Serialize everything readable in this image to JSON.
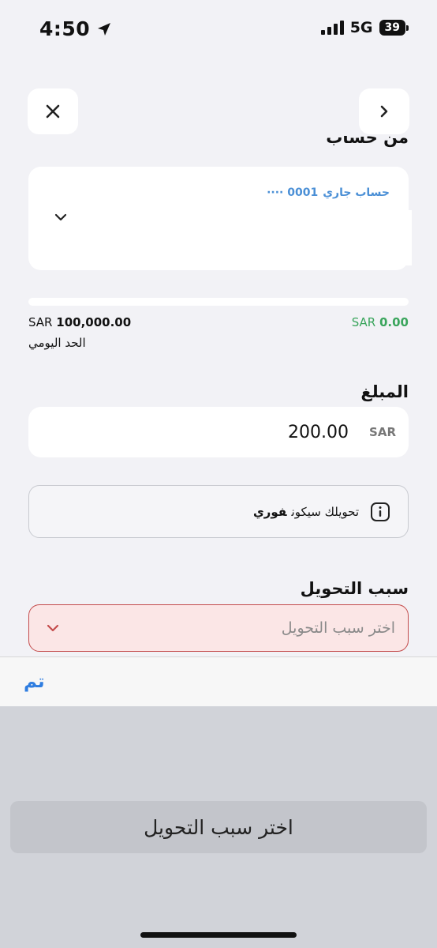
{
  "status_bar": {
    "time": "4:50",
    "network": "5G",
    "battery": "39"
  },
  "from_account": {
    "title": "من حساب",
    "account_name": "حساب جاري",
    "account_number": "0001 ····"
  },
  "limits": {
    "daily_limit_amount": "100,000.00",
    "daily_limit_currency": "SAR",
    "daily_limit_label": "الحد اليومي",
    "used_amount": "0.00",
    "used_currency": "SAR",
    "used_fraction": 0
  },
  "amount": {
    "title": "المبلغ",
    "value": "200.00",
    "currency": "SAR"
  },
  "info": {
    "text": "تحويلك سيكون",
    "emphasis": "فوري"
  },
  "reason": {
    "title": "سبب التحويل",
    "placeholder": "اختر سبب التحويل"
  },
  "picker": {
    "done_label": "تم",
    "selected_option": "اختر سبب التحويل"
  },
  "colors": {
    "accent": "#2f7de0",
    "success": "#3aa55c",
    "error_border": "#c44c4c",
    "error_fill": "#fbe6e6"
  }
}
